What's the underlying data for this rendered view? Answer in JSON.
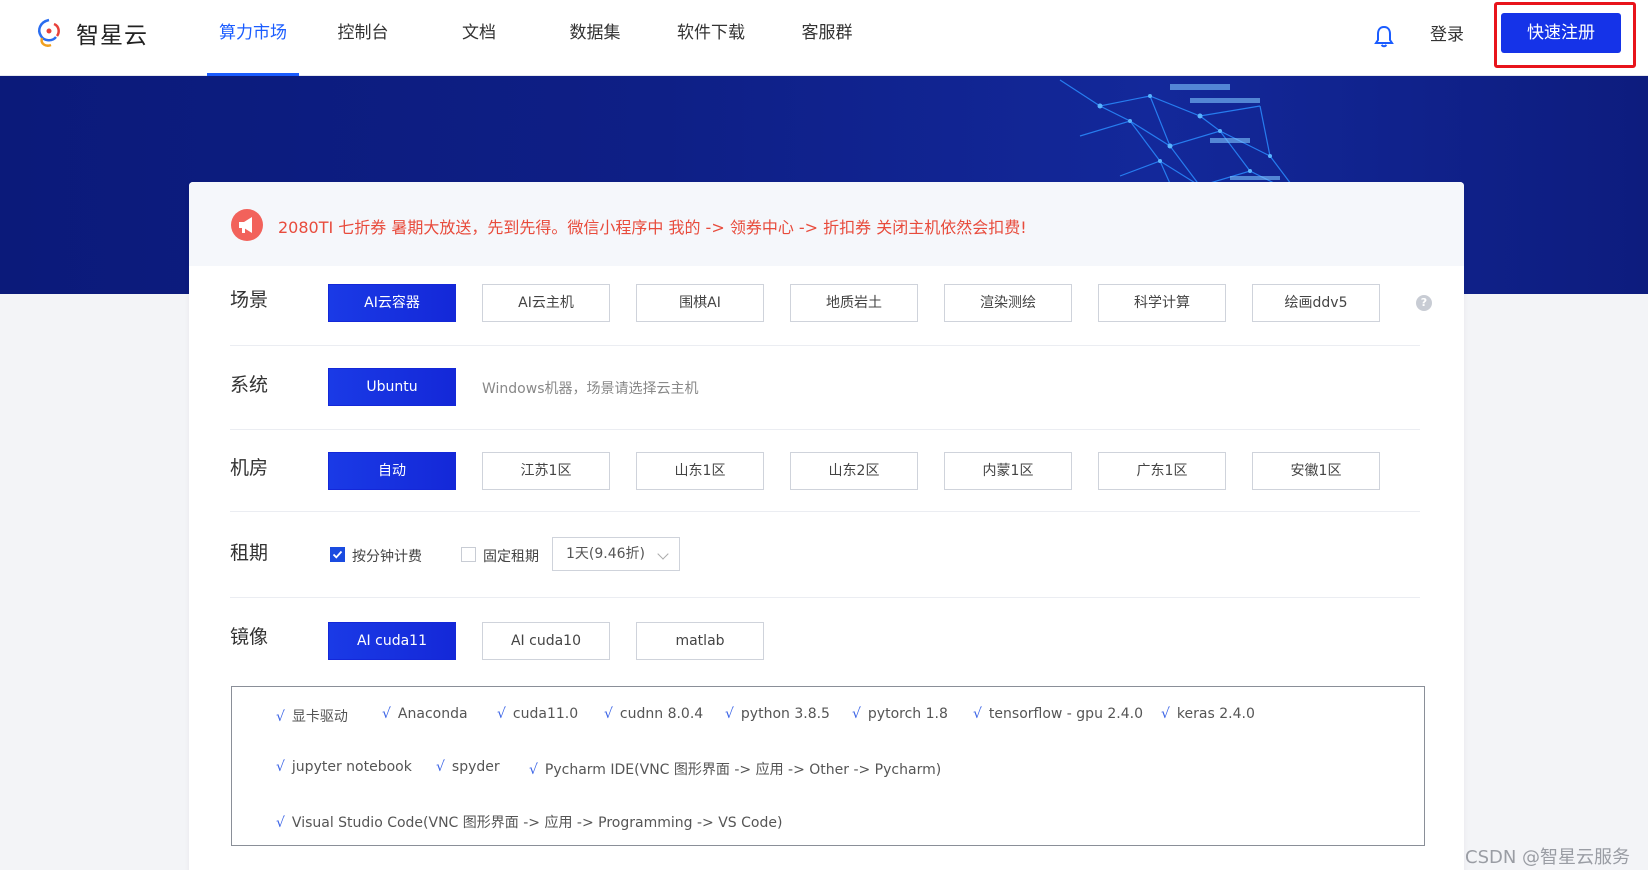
{
  "brand": {
    "name": "智星云"
  },
  "nav": [
    {
      "label": "算力市场",
      "active": true
    },
    {
      "label": "控制台"
    },
    {
      "label": "文档"
    },
    {
      "label": "数据集"
    },
    {
      "label": "软件下载"
    },
    {
      "label": "客服群"
    }
  ],
  "header": {
    "login_label": "登录",
    "register_label": "快速注册",
    "bell_icon": "bell-icon"
  },
  "notice": {
    "icon": "megaphone-icon",
    "text": "2080TI 七折券 暑期大放送，先到先得。微信小程序中 我的 -> 领券中心 -> 折扣券 关闭主机依然会扣费!"
  },
  "scene": {
    "label": "场景",
    "options": [
      "AI云容器",
      "AI云主机",
      "围棋AI",
      "地质岩土",
      "渲染测绘",
      "科学计算",
      "绘画ddv5"
    ],
    "selected": "AI云容器"
  },
  "system": {
    "label": "系统",
    "options": [
      "Ubuntu"
    ],
    "selected": "Ubuntu",
    "hint": "Windows机器，场景请选择云主机"
  },
  "datacenter": {
    "label": "机房",
    "options": [
      "自动",
      "江苏1区",
      "山东1区",
      "山东2区",
      "内蒙1区",
      "广东1区",
      "安徽1区"
    ],
    "selected": "自动"
  },
  "rental": {
    "label": "租期",
    "per_minute_label": "按分钟计费",
    "per_minute_checked": true,
    "fixed_label": "固定租期",
    "fixed_checked": false,
    "duration_value": "1天(9.46折)"
  },
  "image": {
    "label": "镜像",
    "options": [
      "AI cuda11",
      "AI cuda10",
      "matlab"
    ],
    "selected": "AI cuda11",
    "tick": "√",
    "packages": [
      "显卡驱动",
      "Anaconda",
      "cuda11.0",
      "cudnn 8.0.4",
      "python 3.8.5",
      "pytorch 1.8",
      "tensorflow - gpu 2.4.0",
      "keras 2.4.0",
      "jupyter notebook",
      "spyder",
      "Pycharm IDE(VNC 图形界面 -> 应用 -> Other -> Pycharm)",
      "Visual Studio Code(VNC 图形界面 -> 应用 -> Programming -> VS Code)"
    ]
  },
  "watermark": "CSDN @智星云服务",
  "colors": {
    "accent": "#1a5cff",
    "primary_button": "#1533e8",
    "notice_red": "#e84b3c",
    "banner": "#0e1f86"
  }
}
